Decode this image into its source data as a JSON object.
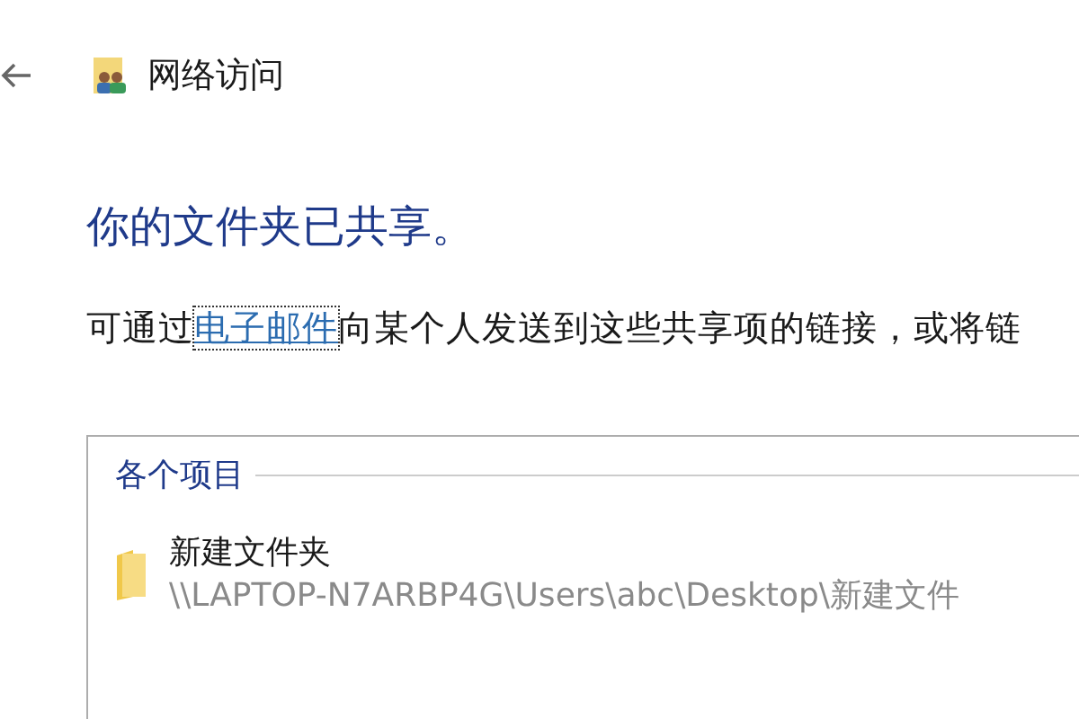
{
  "header": {
    "title": "网络访问"
  },
  "heading": "你的文件夹已共享。",
  "message": {
    "before": "可通过",
    "link": "电子邮件",
    "after": "向某个人发送到这些共享项的链接，或将链"
  },
  "group": {
    "legend": "各个项目",
    "items": [
      {
        "name": "新建文件夹",
        "path": "\\\\LAPTOP-N7ARBP4G\\Users\\abc\\Desktop\\新建文件"
      }
    ]
  }
}
